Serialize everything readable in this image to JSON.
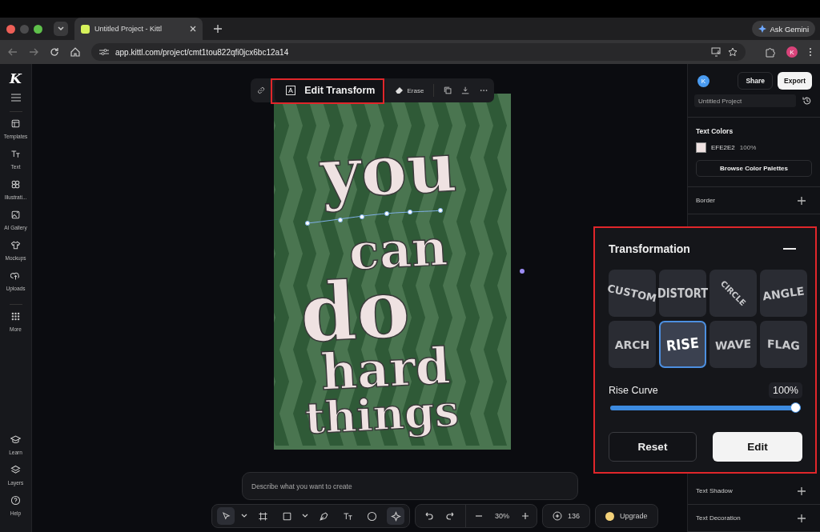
{
  "browser": {
    "tab_title": "Untitled Project - Kittl",
    "url": "app.kittl.com/project/cmt1tou822qfi0jcx6bc12a14",
    "gemini_button": "Ask Gemini",
    "profile_initial": "K"
  },
  "sidebar": {
    "logo": "K",
    "items": [
      {
        "label": "Templates",
        "kind": "templates"
      },
      {
        "label": "Text",
        "kind": "text"
      },
      {
        "label": "Illustrati...",
        "kind": "illustrations"
      },
      {
        "label": "AI Gallery",
        "kind": "gallery"
      },
      {
        "label": "Mockups",
        "kind": "mockups"
      },
      {
        "label": "Uploads",
        "kind": "uploads"
      },
      {
        "label": "More",
        "kind": "more"
      }
    ],
    "bottom_items": [
      {
        "label": "Learn",
        "kind": "learn"
      },
      {
        "label": "Layers",
        "kind": "layers"
      },
      {
        "label": "Help",
        "kind": "help"
      }
    ]
  },
  "floating_toolbar": {
    "edit_transform": "Edit Transform",
    "erase": "Erase"
  },
  "artwork": {
    "lines": [
      "you",
      "can",
      "do",
      "hard",
      "things"
    ]
  },
  "prompt": {
    "placeholder": "Describe what you want to create"
  },
  "bottom_toolbar": {
    "tools": [
      {
        "kind": "select",
        "selected": true,
        "dropdown": true
      },
      {
        "kind": "frame",
        "selected": false,
        "dropdown": false
      },
      {
        "kind": "shape",
        "selected": false,
        "dropdown": true
      },
      {
        "kind": "pen",
        "selected": false,
        "dropdown": false
      },
      {
        "kind": "text",
        "selected": false,
        "dropdown": false
      },
      {
        "kind": "comment",
        "selected": false,
        "dropdown": false
      },
      {
        "kind": "ai",
        "selected": true,
        "dropdown": false
      }
    ],
    "zoom": "30%",
    "credits": "136",
    "upgrade": "Upgrade"
  },
  "right_panel": {
    "avatar": "K",
    "share": "Share",
    "export": "Export",
    "project_name": "Untitled Project",
    "text_colors": {
      "title": "Text Colors",
      "hex": "EFE2E2",
      "opacity": "100%",
      "browse": "Browse Color Palettes"
    },
    "upper_sections": [
      "Border"
    ],
    "lower_sections": [
      "Text Shadow",
      "Text Decoration"
    ]
  },
  "transformation": {
    "title": "Transformation",
    "presets": [
      {
        "label": "CUSTOM",
        "kind": "custom",
        "selected": false
      },
      {
        "label": "DISTORT",
        "kind": "distort",
        "selected": false
      },
      {
        "label": "CIRCLE",
        "kind": "circle",
        "selected": false
      },
      {
        "label": "ANGLE",
        "kind": "angle",
        "selected": false
      },
      {
        "label": "ARCH",
        "kind": "arch",
        "selected": false
      },
      {
        "label": "RISE",
        "kind": "rise",
        "selected": true
      },
      {
        "label": "WAVE",
        "kind": "wave",
        "selected": false
      },
      {
        "label": "FLAG",
        "kind": "flag",
        "selected": false
      }
    ],
    "slider": {
      "label": "Rise Curve",
      "reading": "100%",
      "level": 1
    },
    "reset": "Reset",
    "edit": "Edit"
  }
}
